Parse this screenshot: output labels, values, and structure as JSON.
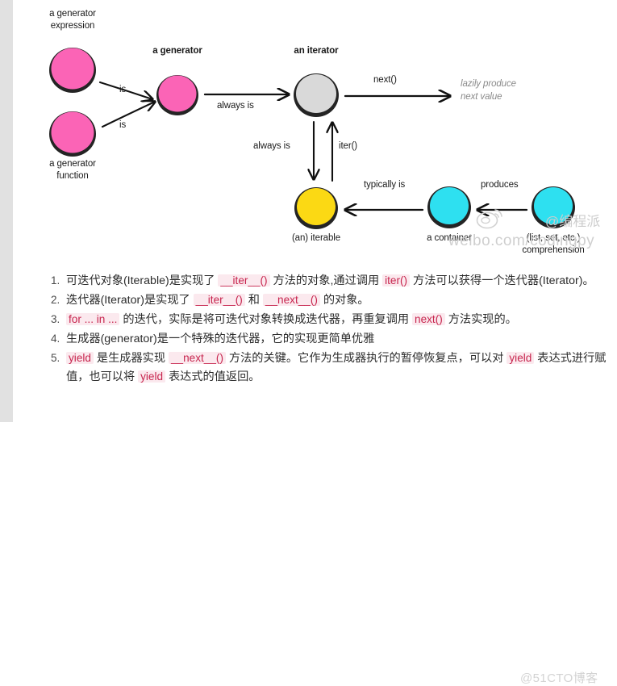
{
  "diagram": {
    "nodes": [
      {
        "id": "generator-expression",
        "label": "a generator\nexpression",
        "color": "#fb64b6",
        "bold": false
      },
      {
        "id": "generator-function",
        "label": "a generator\nfunction",
        "color": "#fb64b6",
        "bold": false
      },
      {
        "id": "generator",
        "label": "a generator",
        "color": "#fb64b6",
        "bold": true
      },
      {
        "id": "iterator",
        "label": "an iterator",
        "color": "#d9d9d9",
        "bold": true
      },
      {
        "id": "iterable",
        "label": "(an) iterable",
        "color": "#fbd914",
        "bold": false
      },
      {
        "id": "container",
        "label": "a container",
        "color": "#2ee0f0",
        "bold": false
      },
      {
        "id": "comprehension",
        "label": "(list, set, etc.)\ncomprehension",
        "color": "#2ee0f0",
        "bold": false
      }
    ],
    "edges": [
      {
        "id": "genexpr-to-generator",
        "label": "is"
      },
      {
        "id": "genfunc-to-generator",
        "label": "is"
      },
      {
        "id": "generator-to-iterator",
        "label": "always is"
      },
      {
        "id": "iterator-to-nextvalue",
        "label": "next()"
      },
      {
        "id": "iterator-to-iterable",
        "label": "always is"
      },
      {
        "id": "iterable-to-iterator",
        "label": "iter()"
      },
      {
        "id": "container-to-iterable",
        "label": "typically is"
      },
      {
        "id": "comprehension-to-container",
        "label": "produces"
      }
    ],
    "notes": [
      {
        "id": "lazily-produce",
        "text": "lazily produce\nnext value"
      }
    ],
    "watermarks": {
      "weibo_url": "weibo.com/codingpy",
      "weibo_handle": "@编程派",
      "cto_blog": "@51CTO博客"
    }
  },
  "notes": {
    "items": [
      {
        "parts": [
          {
            "t": "text",
            "v": "可迭代对象(Iterable)是实现了 "
          },
          {
            "t": "code",
            "v": "__iter__()"
          },
          {
            "t": "text",
            "v": " 方法的对象,通过调用 "
          },
          {
            "t": "code",
            "v": "iter()"
          },
          {
            "t": "text",
            "v": " 方法可以获得一个迭代器(Iterator)。"
          }
        ]
      },
      {
        "parts": [
          {
            "t": "text",
            "v": "迭代器(Iterator)是实现了 "
          },
          {
            "t": "code",
            "v": "__iter__()"
          },
          {
            "t": "text",
            "v": " 和 "
          },
          {
            "t": "code",
            "v": "__next__()"
          },
          {
            "t": "text",
            "v": " 的对象。"
          }
        ]
      },
      {
        "parts": [
          {
            "t": "code",
            "v": "for ... in ..."
          },
          {
            "t": "text",
            "v": " 的迭代，实际是将可迭代对象转换成迭代器，再重复调用 "
          },
          {
            "t": "code",
            "v": "next()"
          },
          {
            "t": "text",
            "v": " 方法实现的。"
          }
        ]
      },
      {
        "parts": [
          {
            "t": "text",
            "v": "生成器(generator)是一个特殊的迭代器，它的实现更简单优雅"
          }
        ]
      },
      {
        "parts": [
          {
            "t": "code",
            "v": "yield"
          },
          {
            "t": "text",
            "v": " 是生成器实现 "
          },
          {
            "t": "code",
            "v": "__next__()"
          },
          {
            "t": "text",
            "v": " 方法的关键。它作为生成器执行的暂停恢复点，可以对 "
          },
          {
            "t": "code",
            "v": "yield"
          },
          {
            "t": "text",
            "v": " 表达式进行赋值，也可以将 "
          },
          {
            "t": "code",
            "v": "yield"
          },
          {
            "t": "text",
            "v": " 表达式的值返回。"
          }
        ]
      }
    ]
  },
  "colors": {
    "pink": "#fb64b6",
    "gray_node": "#d9d9d9",
    "yellow": "#fbd914",
    "cyan": "#2ee0f0",
    "code_text": "#c7254e",
    "code_bg": "#fbe9ee",
    "gutter": "#e1e1e1"
  }
}
